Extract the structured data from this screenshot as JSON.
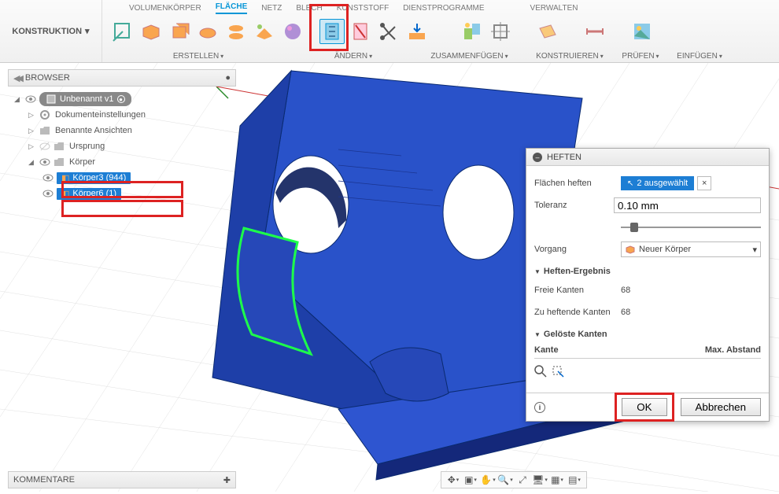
{
  "ribbon": {
    "konstruktion": "KONSTRUKTION",
    "tabs": [
      "VOLUMENKÖRPER",
      "FLÄCHE",
      "NETZ",
      "BLECH",
      "KUNSTSTOFF",
      "DIENSTPROGRAMME",
      "VERWALTEN"
    ],
    "active_tab": 1,
    "labels": {
      "erstellen": "ERSTELLEN",
      "aendern": "ÄNDERN",
      "zusammenfuegen": "ZUSAMMENFÜGEN",
      "konstruieren": "KONSTRUIEREN",
      "pruefen": "PRÜFEN",
      "einfuegen": "EINFÜGEN"
    }
  },
  "browser": {
    "title": "BROWSER",
    "root": "Unbenannt v1",
    "items": [
      {
        "label": "Dokumenteinstellungen"
      },
      {
        "label": "Benannte Ansichten"
      },
      {
        "label": "Ursprung"
      },
      {
        "label": "Körper"
      }
    ],
    "bodies": [
      {
        "label": "Körper3 (944)"
      },
      {
        "label": "Körper6 (1)"
      }
    ]
  },
  "dialog": {
    "title": "HEFTEN",
    "rows": {
      "flaechen_label": "Flächen heften",
      "flaechen_value": "2 ausgewählt",
      "toleranz_label": "Toleranz",
      "toleranz_value": "0.10 mm",
      "vorgang_label": "Vorgang",
      "vorgang_value": "Neuer Körper"
    },
    "section1": "Heften-Ergebnis",
    "freie_label": "Freie Kanten",
    "freie_value": "68",
    "zuheft_label": "Zu heftende Kanten",
    "zuheft_value": "68",
    "section2": "Gelöste Kanten",
    "col1": "Kante",
    "col2": "Max. Abstand",
    "ok": "OK",
    "cancel": "Abbrechen"
  },
  "kommentare": "KOMMENTARE"
}
